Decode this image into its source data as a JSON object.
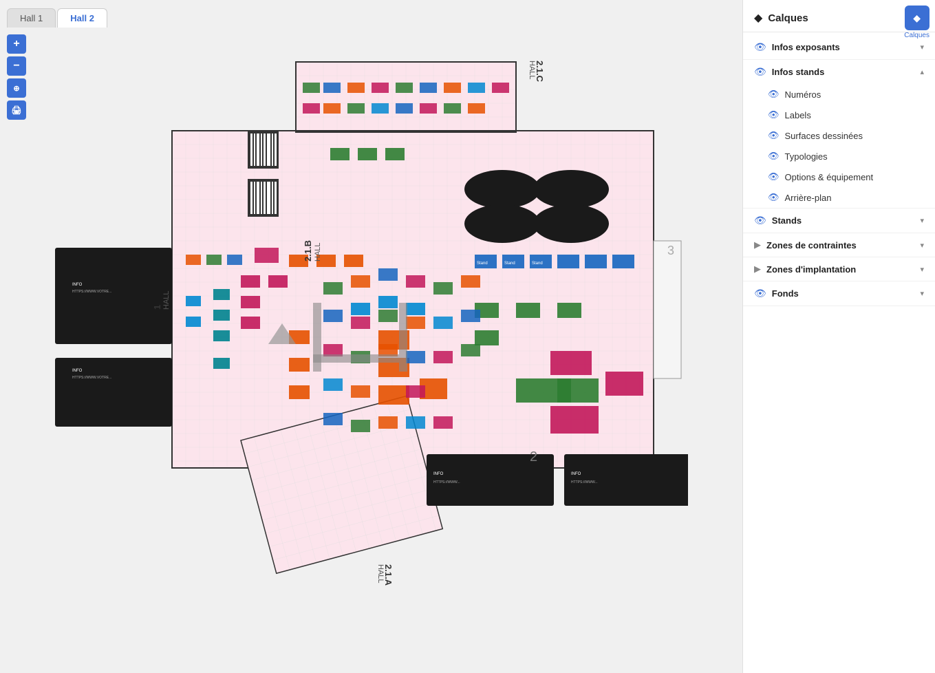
{
  "tabs": [
    {
      "label": "Hall 1",
      "active": false
    },
    {
      "label": "Hall 2",
      "active": true
    }
  ],
  "toolbar": {
    "zoom_in": "+",
    "zoom_out": "−",
    "reset": "⊕",
    "print": "🖨"
  },
  "panel": {
    "title": "Calques",
    "icon": "◆",
    "calques_button_label": "Calques",
    "layers": [
      {
        "label": "Infos exposants",
        "visible": true,
        "expanded": false,
        "children": []
      },
      {
        "label": "Infos stands",
        "visible": true,
        "expanded": true,
        "children": [
          {
            "label": "Numéros",
            "visible": true
          },
          {
            "label": "Labels",
            "visible": true
          },
          {
            "label": "Surfaces dessinées",
            "visible": true
          },
          {
            "label": "Typologies",
            "visible": true
          },
          {
            "label": "Options & équipement",
            "visible": true
          },
          {
            "label": "Arrière-plan",
            "visible": true
          }
        ]
      },
      {
        "label": "Stands",
        "visible": true,
        "expanded": false,
        "children": []
      },
      {
        "label": "Zones de contraintes",
        "visible": false,
        "expanded": false,
        "children": []
      },
      {
        "label": "Zones d'implantation",
        "visible": false,
        "expanded": false,
        "children": []
      },
      {
        "label": "Fonds",
        "visible": true,
        "expanded": false,
        "children": []
      }
    ]
  }
}
